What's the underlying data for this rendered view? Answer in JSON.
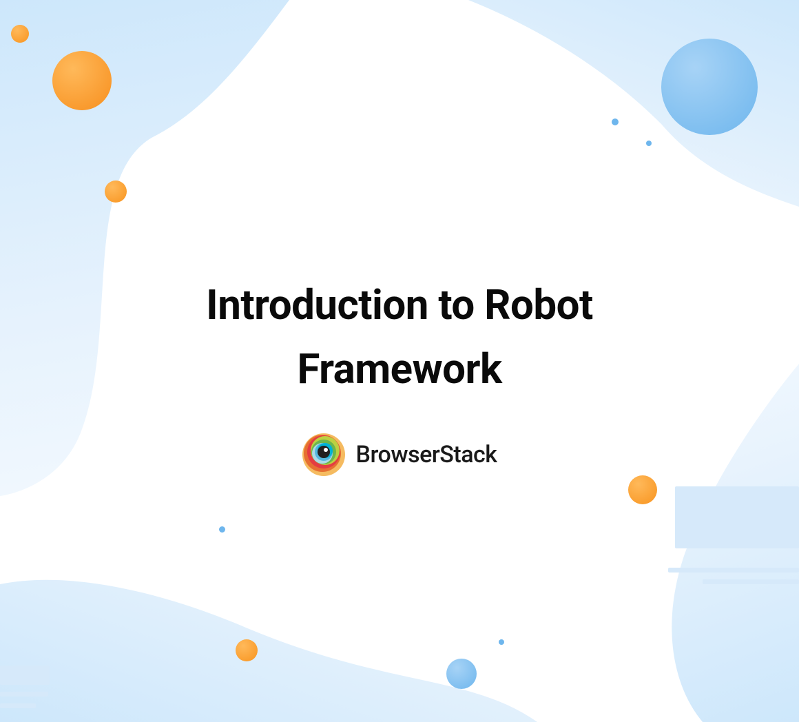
{
  "title": "Introduction to Robot Framework",
  "brand": {
    "name": "BrowserStack",
    "logo_icon": "browserstack-logo-icon"
  },
  "colors": {
    "orange": "#f8941f",
    "blue_light": "#cde7fb",
    "blue_accent": "#6eb6ed",
    "text": "#0a0a0a"
  }
}
